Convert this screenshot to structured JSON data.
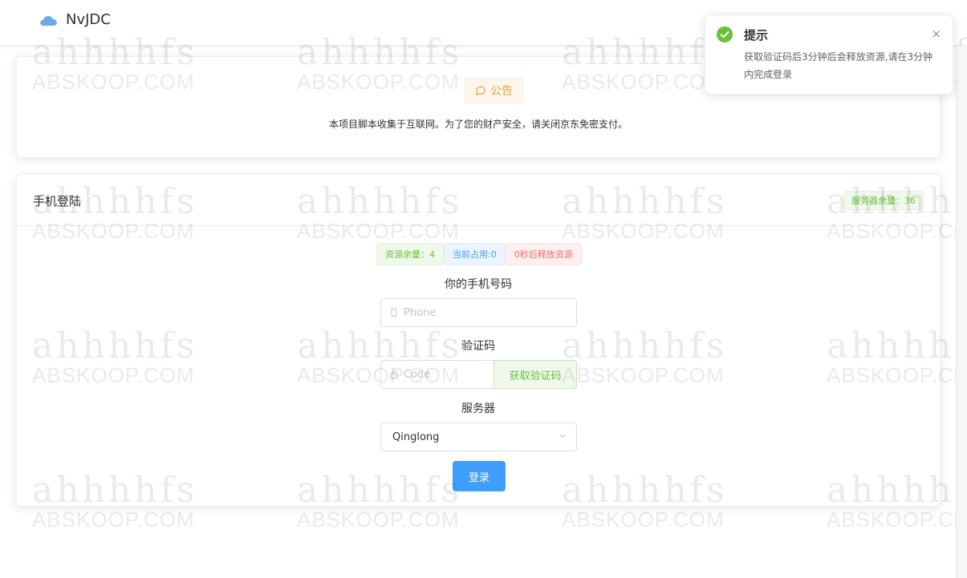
{
  "app": {
    "name": "NvJDC"
  },
  "notice": {
    "tag_label": "公告",
    "text": "本项目脚本收集于互联网。为了您的财产安全，请关闭京东免密支付。"
  },
  "login": {
    "title": "手机登陆",
    "server_remaining": "服务器余量：36",
    "tags": {
      "resource_remaining": "资源余量：4",
      "current_used": "当前占用:0",
      "release_timer": "0秒后释放资源"
    },
    "phone_label": "你的手机号码",
    "phone_placeholder": "Phone",
    "code_label": "验证码",
    "code_placeholder": "Code",
    "get_code_button": "获取验证码",
    "server_label": "服务器",
    "server_value": "Qinglong",
    "submit_button": "登录"
  },
  "toast": {
    "title": "提示",
    "message": "获取验证码后3分钟后会释放资源,请在3分钟内完成登录",
    "close": "×"
  },
  "watermark": {
    "line1": "ahhhhfs",
    "line2": "ABSKOOP.COM"
  },
  "colors": {
    "primary": "#409eff",
    "success": "#67c23a",
    "warning": "#e6a23c",
    "danger": "#f56c6c"
  }
}
